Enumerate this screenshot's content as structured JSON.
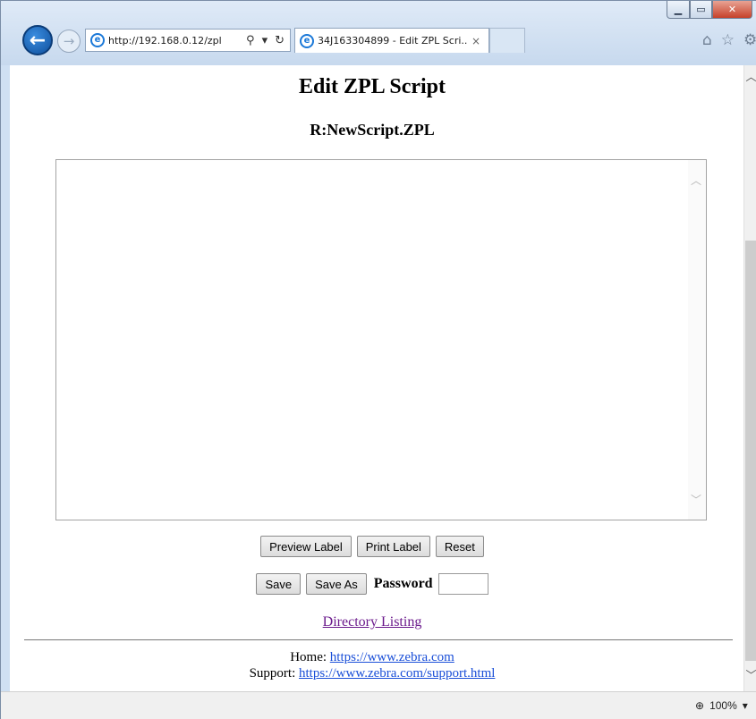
{
  "browser": {
    "address_prefix": "http://",
    "address_host": "192.168.0.12",
    "address_path": "/zpl",
    "tab_title": "34J163304899 - Edit ZPL Scri...",
    "tab_close": "×",
    "zoom_level": "100%"
  },
  "page": {
    "title": "Edit ZPL Script",
    "filename": "R:NewScript.ZPL",
    "script_content": "",
    "buttons": {
      "preview": "Preview Label",
      "print": "Print Label",
      "reset": "Reset",
      "save": "Save",
      "save_as": "Save As"
    },
    "password_label": "Password",
    "password_value": "",
    "directory_link": "Directory Listing",
    "footer": {
      "home_label": "Home: ",
      "home_url": "https://www.zebra.com",
      "support_label": "Support: ",
      "support_url": "https://www.zebra.com/support.html"
    }
  },
  "icons": [
    "back-arrow-icon",
    "forward-arrow-icon",
    "ie-logo-icon",
    "search-icon",
    "refresh-icon",
    "home-icon",
    "favorites-star-icon",
    "settings-gear-icon",
    "zoom-icon"
  ]
}
